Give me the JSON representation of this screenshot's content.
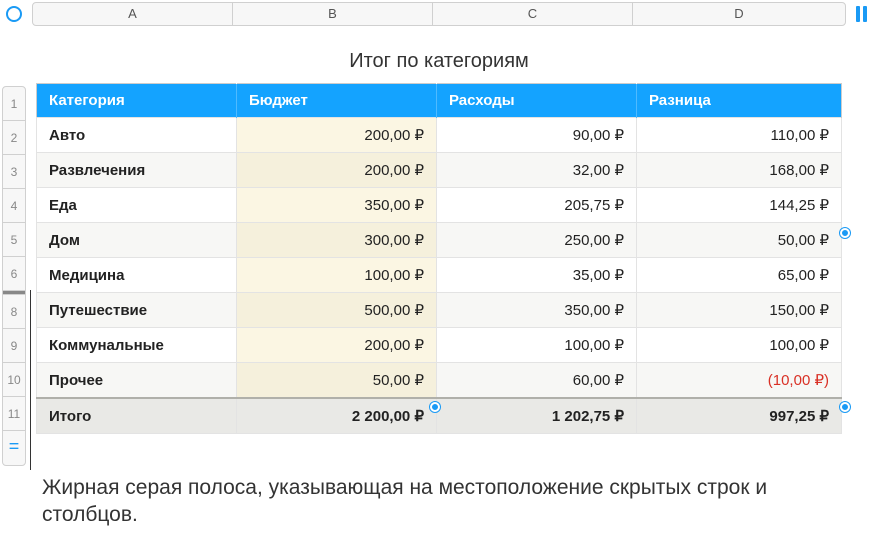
{
  "columns": [
    "A",
    "B",
    "C",
    "D"
  ],
  "row_numbers": [
    "1",
    "2",
    "3",
    "4",
    "5",
    "6",
    "8",
    "9",
    "10",
    "11"
  ],
  "equals_label": "=",
  "title": "Итог по категориям",
  "headers": {
    "cat": "Категория",
    "budget": "Бюджет",
    "expense": "Расходы",
    "diff": "Разница"
  },
  "rows": [
    {
      "cat": "Авто",
      "b": "200,00 ₽",
      "c": "90,00 ₽",
      "d": "110,00 ₽"
    },
    {
      "cat": "Развлечения",
      "b": "200,00 ₽",
      "c": "32,00 ₽",
      "d": "168,00 ₽"
    },
    {
      "cat": "Еда",
      "b": "350,00 ₽",
      "c": "205,75 ₽",
      "d": "144,25 ₽"
    },
    {
      "cat": "Дом",
      "b": "300,00 ₽",
      "c": "250,00 ₽",
      "d": "50,00 ₽"
    },
    {
      "cat": "Медицина",
      "b": "100,00 ₽",
      "c": "35,00 ₽",
      "d": "65,00 ₽"
    },
    {
      "cat": "Путешествие",
      "b": "500,00 ₽",
      "c": "350,00 ₽",
      "d": "150,00 ₽"
    },
    {
      "cat": "Коммунальные",
      "b": "200,00 ₽",
      "c": "100,00 ₽",
      "d": "100,00 ₽"
    },
    {
      "cat": "Прочее",
      "b": "50,00 ₽",
      "c": "60,00 ₽",
      "d": "(10,00 ₽)",
      "neg": true
    }
  ],
  "total": {
    "cat": "Итого",
    "b": "2 200,00 ₽",
    "c": "1 202,75 ₽",
    "d": "997,25 ₽"
  },
  "caption": "Жирная серая полоса, указывающая на местоположение скрытых строк и столбцов."
}
